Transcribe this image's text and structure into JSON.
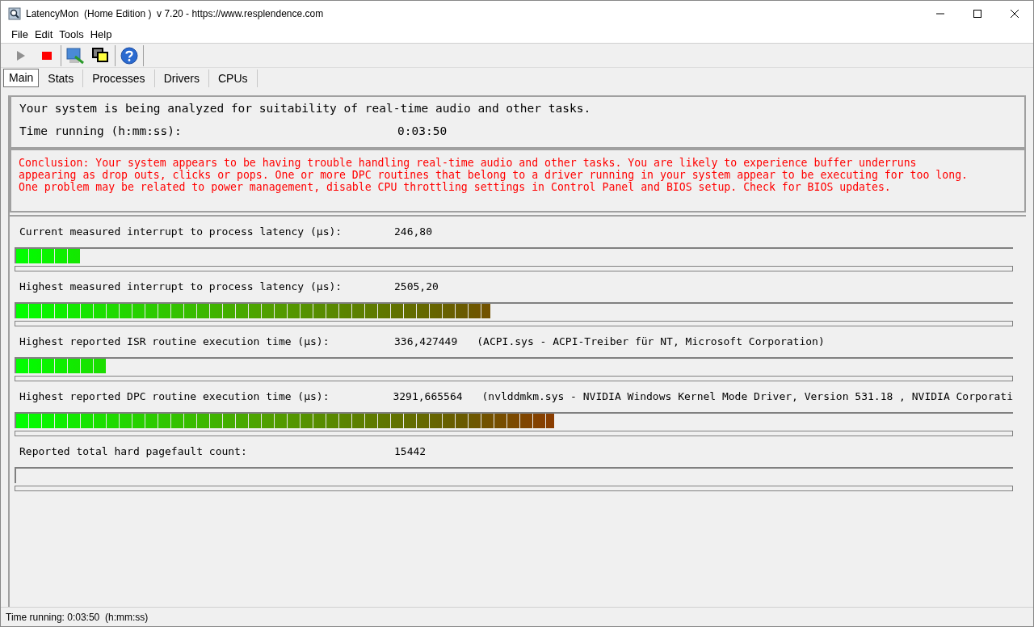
{
  "window": {
    "title": "LatencyMon  (Home Edition )  v 7.20 - https://www.resplendence.com"
  },
  "menu": [
    "File",
    "Edit",
    "Tools",
    "Help"
  ],
  "tabs": [
    {
      "label": "Main",
      "selected": true
    },
    {
      "label": "Stats",
      "selected": false
    },
    {
      "label": "Processes",
      "selected": false
    },
    {
      "label": "Drivers",
      "selected": false
    },
    {
      "label": "CPUs",
      "selected": false
    }
  ],
  "summary": {
    "headline": "Your system is being analyzed for suitability of real-time audio and other tasks.",
    "time_label": "Time running (h:mm:ss):",
    "time_value": "0:03:50"
  },
  "conclusion": "Conclusion: Your system appears to be having trouble handling real-time audio and other tasks. You are likely to experience buffer underruns appearing as drop outs, clicks or pops. One or more DPC routines that belong to a driver running in your system appear to be executing for too long. One problem may be related to power management, disable CPU throttling settings in Control Panel and BIOS setup. Check for BIOS updates.",
  "metrics": [
    {
      "label": "Current measured interrupt to process latency (µs):",
      "value": "246,80",
      "level": 0.064
    },
    {
      "label": "Highest measured interrupt to process latency (µs):",
      "value": "2505,20",
      "level": 0.476
    },
    {
      "label": "Highest reported ISR routine execution time (µs):",
      "value": "336,427449",
      "detail": "(ACPI.sys - ACPI-Treiber für NT, Microsoft Corporation)",
      "level": 0.09
    },
    {
      "label": "Highest reported DPC routine execution time (µs):",
      "value": "3291,665564",
      "detail": "(nvlddmkm.sys - NVIDIA Windows Kernel Mode Driver, Version 531.18 , NVIDIA Corporati",
      "level": 0.54
    },
    {
      "label": "Reported total hard pagefault count:",
      "value": "15442"
    }
  ],
  "status_bar": "Time running: 0:03:50  (h:mm:ss)"
}
